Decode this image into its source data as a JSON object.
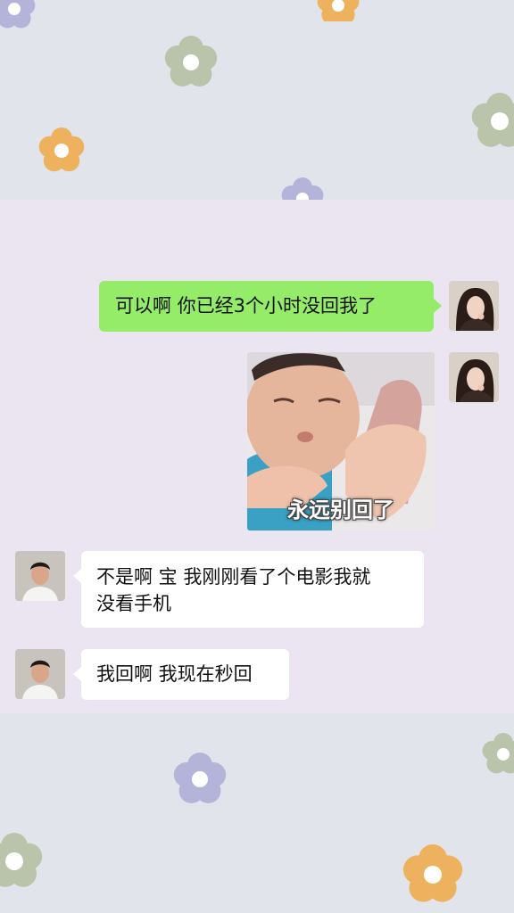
{
  "chat": {
    "messages": [
      {
        "side": "right",
        "type": "text",
        "text": "可以啊 你已经3个小时没回我了"
      },
      {
        "side": "right",
        "type": "sticker",
        "caption": "永远别回了"
      },
      {
        "side": "left",
        "type": "text",
        "lines": [
          "不是啊 宝 我刚刚看了个电影我就",
          "没看手机"
        ]
      },
      {
        "side": "left",
        "type": "text",
        "text": "我回啊 我现在秒回"
      }
    ]
  },
  "colors": {
    "background": "#e2e4ec",
    "chat_panel": "#ebe4f1",
    "bubble_right": "#95ec69",
    "bubble_left": "#ffffff",
    "flower_orange": "#eeb25e",
    "flower_sage": "#b9c4aa",
    "flower_lavender": "#b4b3d9"
  }
}
